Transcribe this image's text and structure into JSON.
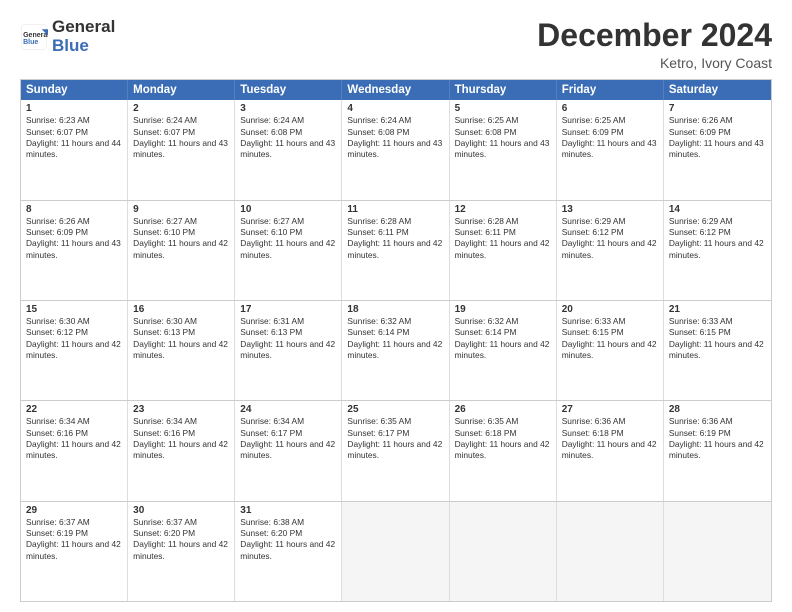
{
  "logo": {
    "line1": "General",
    "line2": "Blue"
  },
  "title": "December 2024",
  "subtitle": "Ketro, Ivory Coast",
  "days_of_week": [
    "Sunday",
    "Monday",
    "Tuesday",
    "Wednesday",
    "Thursday",
    "Friday",
    "Saturday"
  ],
  "weeks": [
    [
      {
        "num": "1",
        "sunrise": "6:23 AM",
        "sunset": "6:07 PM",
        "daylight": "11 hours and 44 minutes."
      },
      {
        "num": "2",
        "sunrise": "6:24 AM",
        "sunset": "6:07 PM",
        "daylight": "11 hours and 43 minutes."
      },
      {
        "num": "3",
        "sunrise": "6:24 AM",
        "sunset": "6:08 PM",
        "daylight": "11 hours and 43 minutes."
      },
      {
        "num": "4",
        "sunrise": "6:24 AM",
        "sunset": "6:08 PM",
        "daylight": "11 hours and 43 minutes."
      },
      {
        "num": "5",
        "sunrise": "6:25 AM",
        "sunset": "6:08 PM",
        "daylight": "11 hours and 43 minutes."
      },
      {
        "num": "6",
        "sunrise": "6:25 AM",
        "sunset": "6:09 PM",
        "daylight": "11 hours and 43 minutes."
      },
      {
        "num": "7",
        "sunrise": "6:26 AM",
        "sunset": "6:09 PM",
        "daylight": "11 hours and 43 minutes."
      }
    ],
    [
      {
        "num": "8",
        "sunrise": "6:26 AM",
        "sunset": "6:09 PM",
        "daylight": "11 hours and 43 minutes."
      },
      {
        "num": "9",
        "sunrise": "6:27 AM",
        "sunset": "6:10 PM",
        "daylight": "11 hours and 42 minutes."
      },
      {
        "num": "10",
        "sunrise": "6:27 AM",
        "sunset": "6:10 PM",
        "daylight": "11 hours and 42 minutes."
      },
      {
        "num": "11",
        "sunrise": "6:28 AM",
        "sunset": "6:11 PM",
        "daylight": "11 hours and 42 minutes."
      },
      {
        "num": "12",
        "sunrise": "6:28 AM",
        "sunset": "6:11 PM",
        "daylight": "11 hours and 42 minutes."
      },
      {
        "num": "13",
        "sunrise": "6:29 AM",
        "sunset": "6:12 PM",
        "daylight": "11 hours and 42 minutes."
      },
      {
        "num": "14",
        "sunrise": "6:29 AM",
        "sunset": "6:12 PM",
        "daylight": "11 hours and 42 minutes."
      }
    ],
    [
      {
        "num": "15",
        "sunrise": "6:30 AM",
        "sunset": "6:12 PM",
        "daylight": "11 hours and 42 minutes."
      },
      {
        "num": "16",
        "sunrise": "6:30 AM",
        "sunset": "6:13 PM",
        "daylight": "11 hours and 42 minutes."
      },
      {
        "num": "17",
        "sunrise": "6:31 AM",
        "sunset": "6:13 PM",
        "daylight": "11 hours and 42 minutes."
      },
      {
        "num": "18",
        "sunrise": "6:32 AM",
        "sunset": "6:14 PM",
        "daylight": "11 hours and 42 minutes."
      },
      {
        "num": "19",
        "sunrise": "6:32 AM",
        "sunset": "6:14 PM",
        "daylight": "11 hours and 42 minutes."
      },
      {
        "num": "20",
        "sunrise": "6:33 AM",
        "sunset": "6:15 PM",
        "daylight": "11 hours and 42 minutes."
      },
      {
        "num": "21",
        "sunrise": "6:33 AM",
        "sunset": "6:15 PM",
        "daylight": "11 hours and 42 minutes."
      }
    ],
    [
      {
        "num": "22",
        "sunrise": "6:34 AM",
        "sunset": "6:16 PM",
        "daylight": "11 hours and 42 minutes."
      },
      {
        "num": "23",
        "sunrise": "6:34 AM",
        "sunset": "6:16 PM",
        "daylight": "11 hours and 42 minutes."
      },
      {
        "num": "24",
        "sunrise": "6:34 AM",
        "sunset": "6:17 PM",
        "daylight": "11 hours and 42 minutes."
      },
      {
        "num": "25",
        "sunrise": "6:35 AM",
        "sunset": "6:17 PM",
        "daylight": "11 hours and 42 minutes."
      },
      {
        "num": "26",
        "sunrise": "6:35 AM",
        "sunset": "6:18 PM",
        "daylight": "11 hours and 42 minutes."
      },
      {
        "num": "27",
        "sunrise": "6:36 AM",
        "sunset": "6:18 PM",
        "daylight": "11 hours and 42 minutes."
      },
      {
        "num": "28",
        "sunrise": "6:36 AM",
        "sunset": "6:19 PM",
        "daylight": "11 hours and 42 minutes."
      }
    ],
    [
      {
        "num": "29",
        "sunrise": "6:37 AM",
        "sunset": "6:19 PM",
        "daylight": "11 hours and 42 minutes."
      },
      {
        "num": "30",
        "sunrise": "6:37 AM",
        "sunset": "6:20 PM",
        "daylight": "11 hours and 42 minutes."
      },
      {
        "num": "31",
        "sunrise": "6:38 AM",
        "sunset": "6:20 PM",
        "daylight": "11 hours and 42 minutes."
      },
      null,
      null,
      null,
      null
    ]
  ]
}
